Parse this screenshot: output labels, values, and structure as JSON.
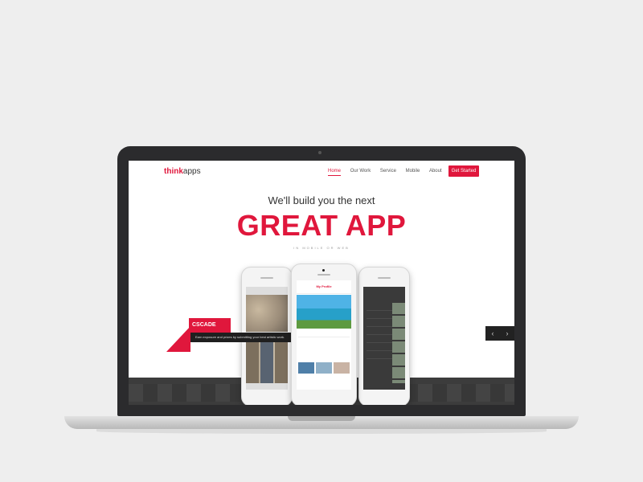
{
  "nav": {
    "logo_think": "think",
    "logo_apps": "apps",
    "links": [
      "Home",
      "Our Work",
      "Service",
      "Mobile",
      "About"
    ],
    "cta": "Get Started"
  },
  "hero": {
    "subtitle": "We'll build you the next",
    "title": "GREAT APP",
    "tagline": "IN MOBILE OR WEB"
  },
  "center_phone": {
    "title": "My Profile"
  },
  "feature": {
    "label": "CSCADE",
    "caption": "Earn exposure and prizes by submitting your best artistic work."
  },
  "colors": {
    "accent": "#e0173c",
    "text": "#333333",
    "dark_band": "#3c3c3c"
  },
  "icons": {
    "slider_prev": "chevron-left-icon",
    "slider_next": "chevron-right-icon"
  }
}
